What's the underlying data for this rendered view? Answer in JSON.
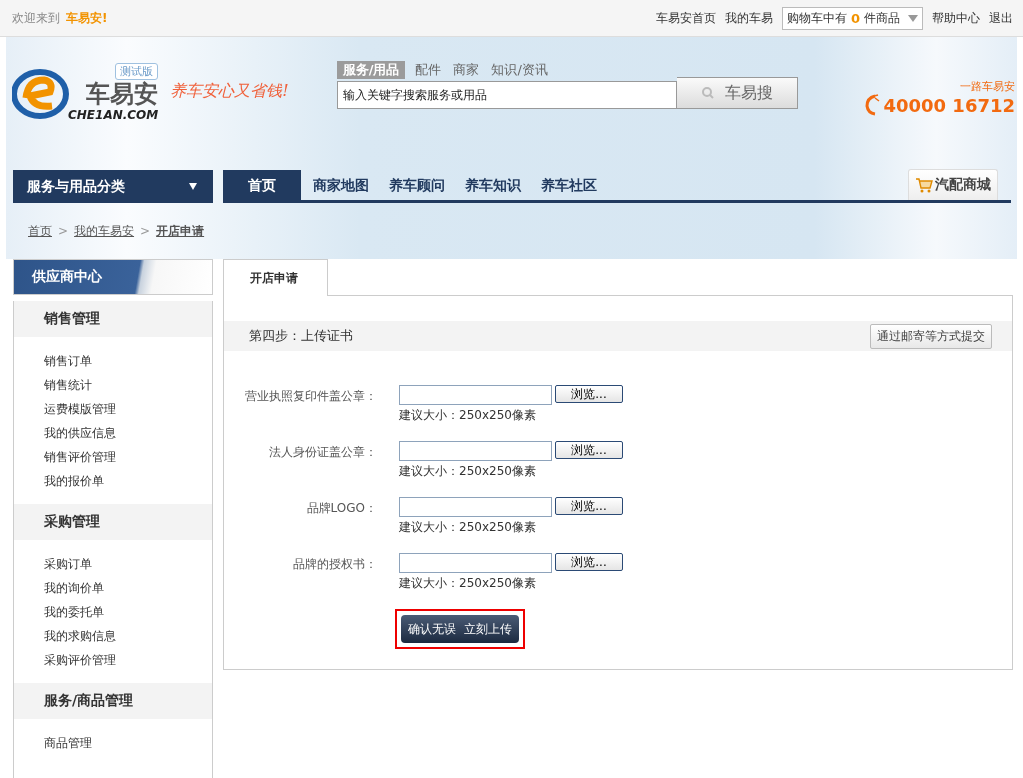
{
  "top_bar": {
    "welcome": "欢迎来到",
    "site_name": "车易安!",
    "links": [
      "车易安首页",
      "我的车易"
    ],
    "cart": {
      "prefix": "购物车中有",
      "count": "0",
      "suffix": "件商品"
    },
    "right_links": [
      "帮助中心",
      "退出"
    ]
  },
  "header": {
    "logo": {
      "badge": "测试版",
      "name": "车易安",
      "domain": "CHE1AN.COM"
    },
    "slogan": "养车安心又省钱!",
    "search": {
      "tabs": [
        {
          "label": "服务/用品",
          "selected": true
        },
        {
          "label": "配件",
          "selected": false
        },
        {
          "label": "商家",
          "selected": false
        },
        {
          "label": "知识/资讯",
          "selected": false
        }
      ],
      "placeholder": "输入关键字搜索服务或用品",
      "button": "车易搜"
    },
    "hotline": {
      "tagline": "一路车易安",
      "number": "40000 16712"
    }
  },
  "nav": {
    "category": "服务与用品分类",
    "items": [
      {
        "label": "首页",
        "selected": true
      },
      {
        "label": "商家地图",
        "selected": false
      },
      {
        "label": "养车顾问",
        "selected": false
      },
      {
        "label": "养车知识",
        "selected": false
      },
      {
        "label": "养车社区",
        "selected": false
      }
    ],
    "mall": "汽配商城"
  },
  "breadcrumb_separator": ">",
  "breadcrumb": [
    {
      "label": "首页",
      "current": false
    },
    {
      "label": "我的车易安",
      "current": false
    },
    {
      "label": "开店申请",
      "current": true
    }
  ],
  "sidebar": {
    "title": "供应商中心",
    "sections": [
      {
        "title": "销售管理",
        "items": [
          "销售订单",
          "销售统计",
          "运费模版管理",
          "我的供应信息",
          "销售评价管理",
          "我的报价单"
        ]
      },
      {
        "title": "采购管理",
        "items": [
          "采购订单",
          "我的询价单",
          "我的委托单",
          "我的求购信息",
          "采购评价管理"
        ]
      },
      {
        "title": "服务/商品管理",
        "items": [
          "商品管理"
        ]
      }
    ]
  },
  "main": {
    "tab": "开店申请",
    "step": "第四步：上传证书",
    "mail_button": "通过邮寄等方式提交",
    "fields": [
      {
        "label": "营业执照复印件盖公章：",
        "browse": "浏览...",
        "hint": "建议大小：250x250像素"
      },
      {
        "label": "法人身份证盖公章：",
        "browse": "浏览...",
        "hint": "建议大小：250x250像素"
      },
      {
        "label": "品牌LOGO：",
        "browse": "浏览...",
        "hint": "建议大小：250x250像素"
      },
      {
        "label": "品牌的授权书：",
        "browse": "浏览...",
        "hint": "建议大小：250x250像素"
      }
    ],
    "submit": "确认无误  立刻上传"
  }
}
